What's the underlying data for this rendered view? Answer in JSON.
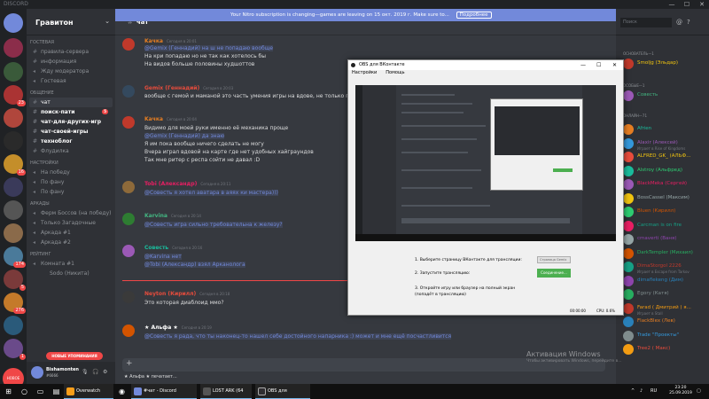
{
  "window": {
    "title": "DISCORD",
    "minimize": "—",
    "maximize": "☐",
    "close": "✕"
  },
  "banner": {
    "text": "Your Nitro subscription is changing—games are leaving on 15 окт. 2019 г. Make sure to...",
    "button": "Подробнее"
  },
  "guilds": {
    "badges": [
      "23",
      "16",
      "174",
      "5",
      "276",
      "1"
    ],
    "new_label": "НОВОЕ"
  },
  "sidebar": {
    "server_name": "Гравитон",
    "categories": {
      "guest": "ГОСТЕВАЯ",
      "general": "ОБЩЕНИЕ",
      "settings": "НАСТРОЙКИ",
      "arcade": "АРКАДЫ",
      "rating": "РЕЙТИНГ"
    },
    "guest_channels": [
      "правила-сервера",
      "информация",
      "Жду модератора",
      "Гостевая"
    ],
    "general_channels": [
      "чат",
      "поиск-пати",
      "чат-для-других-игр",
      "чат-своей-игры",
      "техноблог",
      "Флудилка"
    ],
    "active_badge": "5",
    "settings_channels": [
      "На победу",
      "По фану",
      "По фану"
    ],
    "arcade_channels": [
      "Ферм Боссов (на победу)",
      "Только Загадочные",
      "Аркада #1",
      "Аркада #2"
    ],
    "rating_channels": [
      "Комната #1",
      "Sodo (Никита)"
    ],
    "new_mentions": "НОВЫЕ УПОМИНАНИЯ",
    "user": {
      "name": "Bishamonten",
      "tag": "#6666"
    }
  },
  "chat": {
    "channel": "чат",
    "messages": [
      {
        "author": "Kaчка",
        "time": "Сегодня в 20:01",
        "lines": [
          "@Gemix (Геннадий) на ш не попадаю вообще",
          "На кри попадаю но не так как хотелось бы",
          "На видов больше половины худшоттов"
        ]
      },
      {
        "author": "Gemix (Геннадий)",
        "time": "Сегодня в 20:03",
        "lines": [
          "вообще с гемой и маманой это часть умения игры на вдове, не только попадать"
        ]
      },
      {
        "author": "Kaчка",
        "time": "Сегодня в 20:04",
        "lines": [
          "Видимо для моей руки именно её механика проще",
          "@Gemix (Геннадий) да знаю",
          "Я им пока вообще ничего сделать не могу",
          "Вчера играл вдовой на карте где нет удобных хайграундов",
          "Так мне ритер с респа сойти не давал :D"
        ]
      },
      {
        "author": "Tobi (Александр)",
        "time": "Сегодня в 20:11",
        "lines": [
          "@Совесть я хотел аватара в аяях ки мастера)))"
        ]
      },
      {
        "author": "Karvina",
        "time": "Сегодня в 20:14",
        "lines": [
          "@Совесть игра сильно требовательна к железу?"
        ]
      },
      {
        "author": "Совесть",
        "time": "Сегодня в 20:16",
        "lines": [
          "@Karvina нет",
          "@Tobi (Александр) взял Арканолога"
        ]
      },
      {
        "author": "Neyton (Кирилл)",
        "time": "Сегодня в 20:18",
        "lines": [
          "Это которая диаблоид ммо?"
        ]
      },
      {
        "author": "★ Альфа ★",
        "time": "Сегодня в 20:19",
        "lines": [
          "@Совесть я рада, что ты наконец-то нашел себе достойного напарника :) может и мне ещё посчастливится"
        ]
      }
    ],
    "divider": "НОВОЕ",
    "typing": "★ Альфа ★ печатает..."
  },
  "members": {
    "search": "Поиск",
    "roles": [
      "ОСНОВАТЕЛЬ—1",
      "ОСОБЫЕ—1",
      "ОНЛАЙН—71"
    ],
    "founder": "Smoljg (Эльдар)",
    "special": "Совесть",
    "online": [
      {
        "name": "Afrien",
        "status": ""
      },
      {
        "name": "Alaxir (Алексей)",
        "status": "Играет в Rise of Kingdoms"
      },
      {
        "name": "ALFRED_GK_ (АЛЬФ...",
        "status": ""
      },
      {
        "name": "Alstroy (Альфред)",
        "status": ""
      },
      {
        "name": "BlackMeka (Сергей)",
        "status": ""
      },
      {
        "name": "BossCassel (Максим)",
        "status": ""
      },
      {
        "name": "Bluen (Кирилл)",
        "status": ""
      },
      {
        "name": "Carcman is on fire",
        "status": ""
      },
      {
        "name": "cmaverti (Ваня)",
        "status": ""
      },
      {
        "name": "DarkTempler (Михаил)",
        "status": ""
      },
      {
        "name": "DimaStorgol 2226",
        "status": "Играет в Escape from Tarkov"
      },
      {
        "name": "dimaflekeng (Дим)",
        "status": ""
      },
      {
        "name": "Egory (Катя)",
        "status": ""
      },
      {
        "name": "Farad ( Дмитрий ) я...",
        "status": "Играет в Stall"
      },
      {
        "name": "FlackBlex (Лев)",
        "status": ""
      },
      {
        "name": "Trade \"Проекты\"",
        "status": ""
      },
      {
        "name": "Tree2 ( Макс)",
        "status": ""
      }
    ]
  },
  "obs": {
    "title": "OBS для ВКонтакте",
    "menu": [
      "Настройки",
      "Помощь"
    ],
    "step1": "1. Выберите страницу ВКонтакте для трансляции:",
    "step1_value": "Страница Gemix",
    "step2": "2. Запустите трансляцию:",
    "step2_button": "Соединение...",
    "step3_line1": "3. Откройте игру или браузер на полный экран",
    "step3_line2": "(попадёт в трансляцию)",
    "status_time": "00:00:00",
    "status_cpu": "CPU: 0.6%"
  },
  "watermark": {
    "title": "Активация Windows",
    "subtitle": "Чтобы активировать Windows, перейдите в..."
  },
  "taskbar": {
    "items": [
      "Overwatch",
      "#чат - Discord",
      "LOST ARK (64 bit) - ...",
      "OBS для ВКонтакте"
    ],
    "lang": "ENG",
    "layout": "RU",
    "time": "23:20",
    "date": "25.09.2019"
  }
}
